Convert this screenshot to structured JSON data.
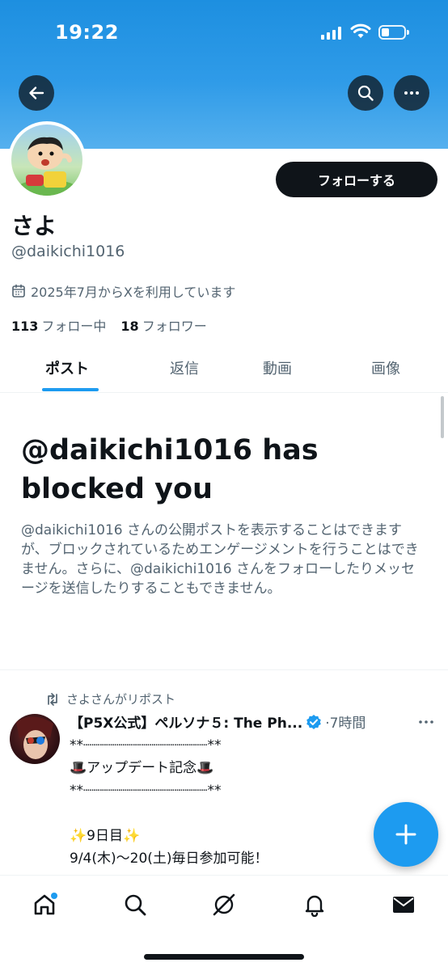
{
  "status_bar": {
    "time": "19:22"
  },
  "profile": {
    "display_name": "さよ",
    "handle": "@daikichi1016",
    "joined": "2025年7月からXを利用しています",
    "following_count": "113",
    "following_label": "フォロー中",
    "followers_count": "18",
    "followers_label": "フォロワー",
    "follow_button": "フォローする"
  },
  "tabs": [
    {
      "label": "ポスト",
      "active": true
    },
    {
      "label": "返信"
    },
    {
      "label": "動画"
    },
    {
      "label": "画像"
    }
  ],
  "blocked": {
    "title": "@daikichi1016 has blocked you",
    "message": "@daikichi1016 さんの公開ポストを表示することはできますが、ブロックされているためエンゲージメントを行うことはできません。さらに、@daikichi1016 さんをフォローしたりメッセージを送信したりすることもできません。"
  },
  "post": {
    "repost_label": "さよさんがリポスト",
    "author": "【P5X公式】ペルソナ５: The Ph...",
    "verified": true,
    "time": "·7時間",
    "body": "**┈┈┈┈┈┈┈┈┈┈┈┈┈┈┈**\n🎩アップデート記念🎩\n**┈┈┈┈┈┈┈┈┈┈┈┈┈┈┈**\n\n✨9日目✨\n9/4(木)〜20(土)毎日参加可能！"
  },
  "icons": {
    "back": "arrow-left-icon",
    "search": "search-icon",
    "more": "more-horizontal-icon",
    "calendar": "calendar-icon",
    "repost": "repost-icon",
    "verified": "verified-badge-icon",
    "compose": "plus-icon",
    "nav": [
      "home-icon",
      "search-icon",
      "grok-icon",
      "notifications-icon",
      "messages-icon"
    ]
  },
  "colors": {
    "accent": "#1d9bf0",
    "text": "#0f1419",
    "muted": "#536471",
    "banner": "#2f9be8"
  }
}
